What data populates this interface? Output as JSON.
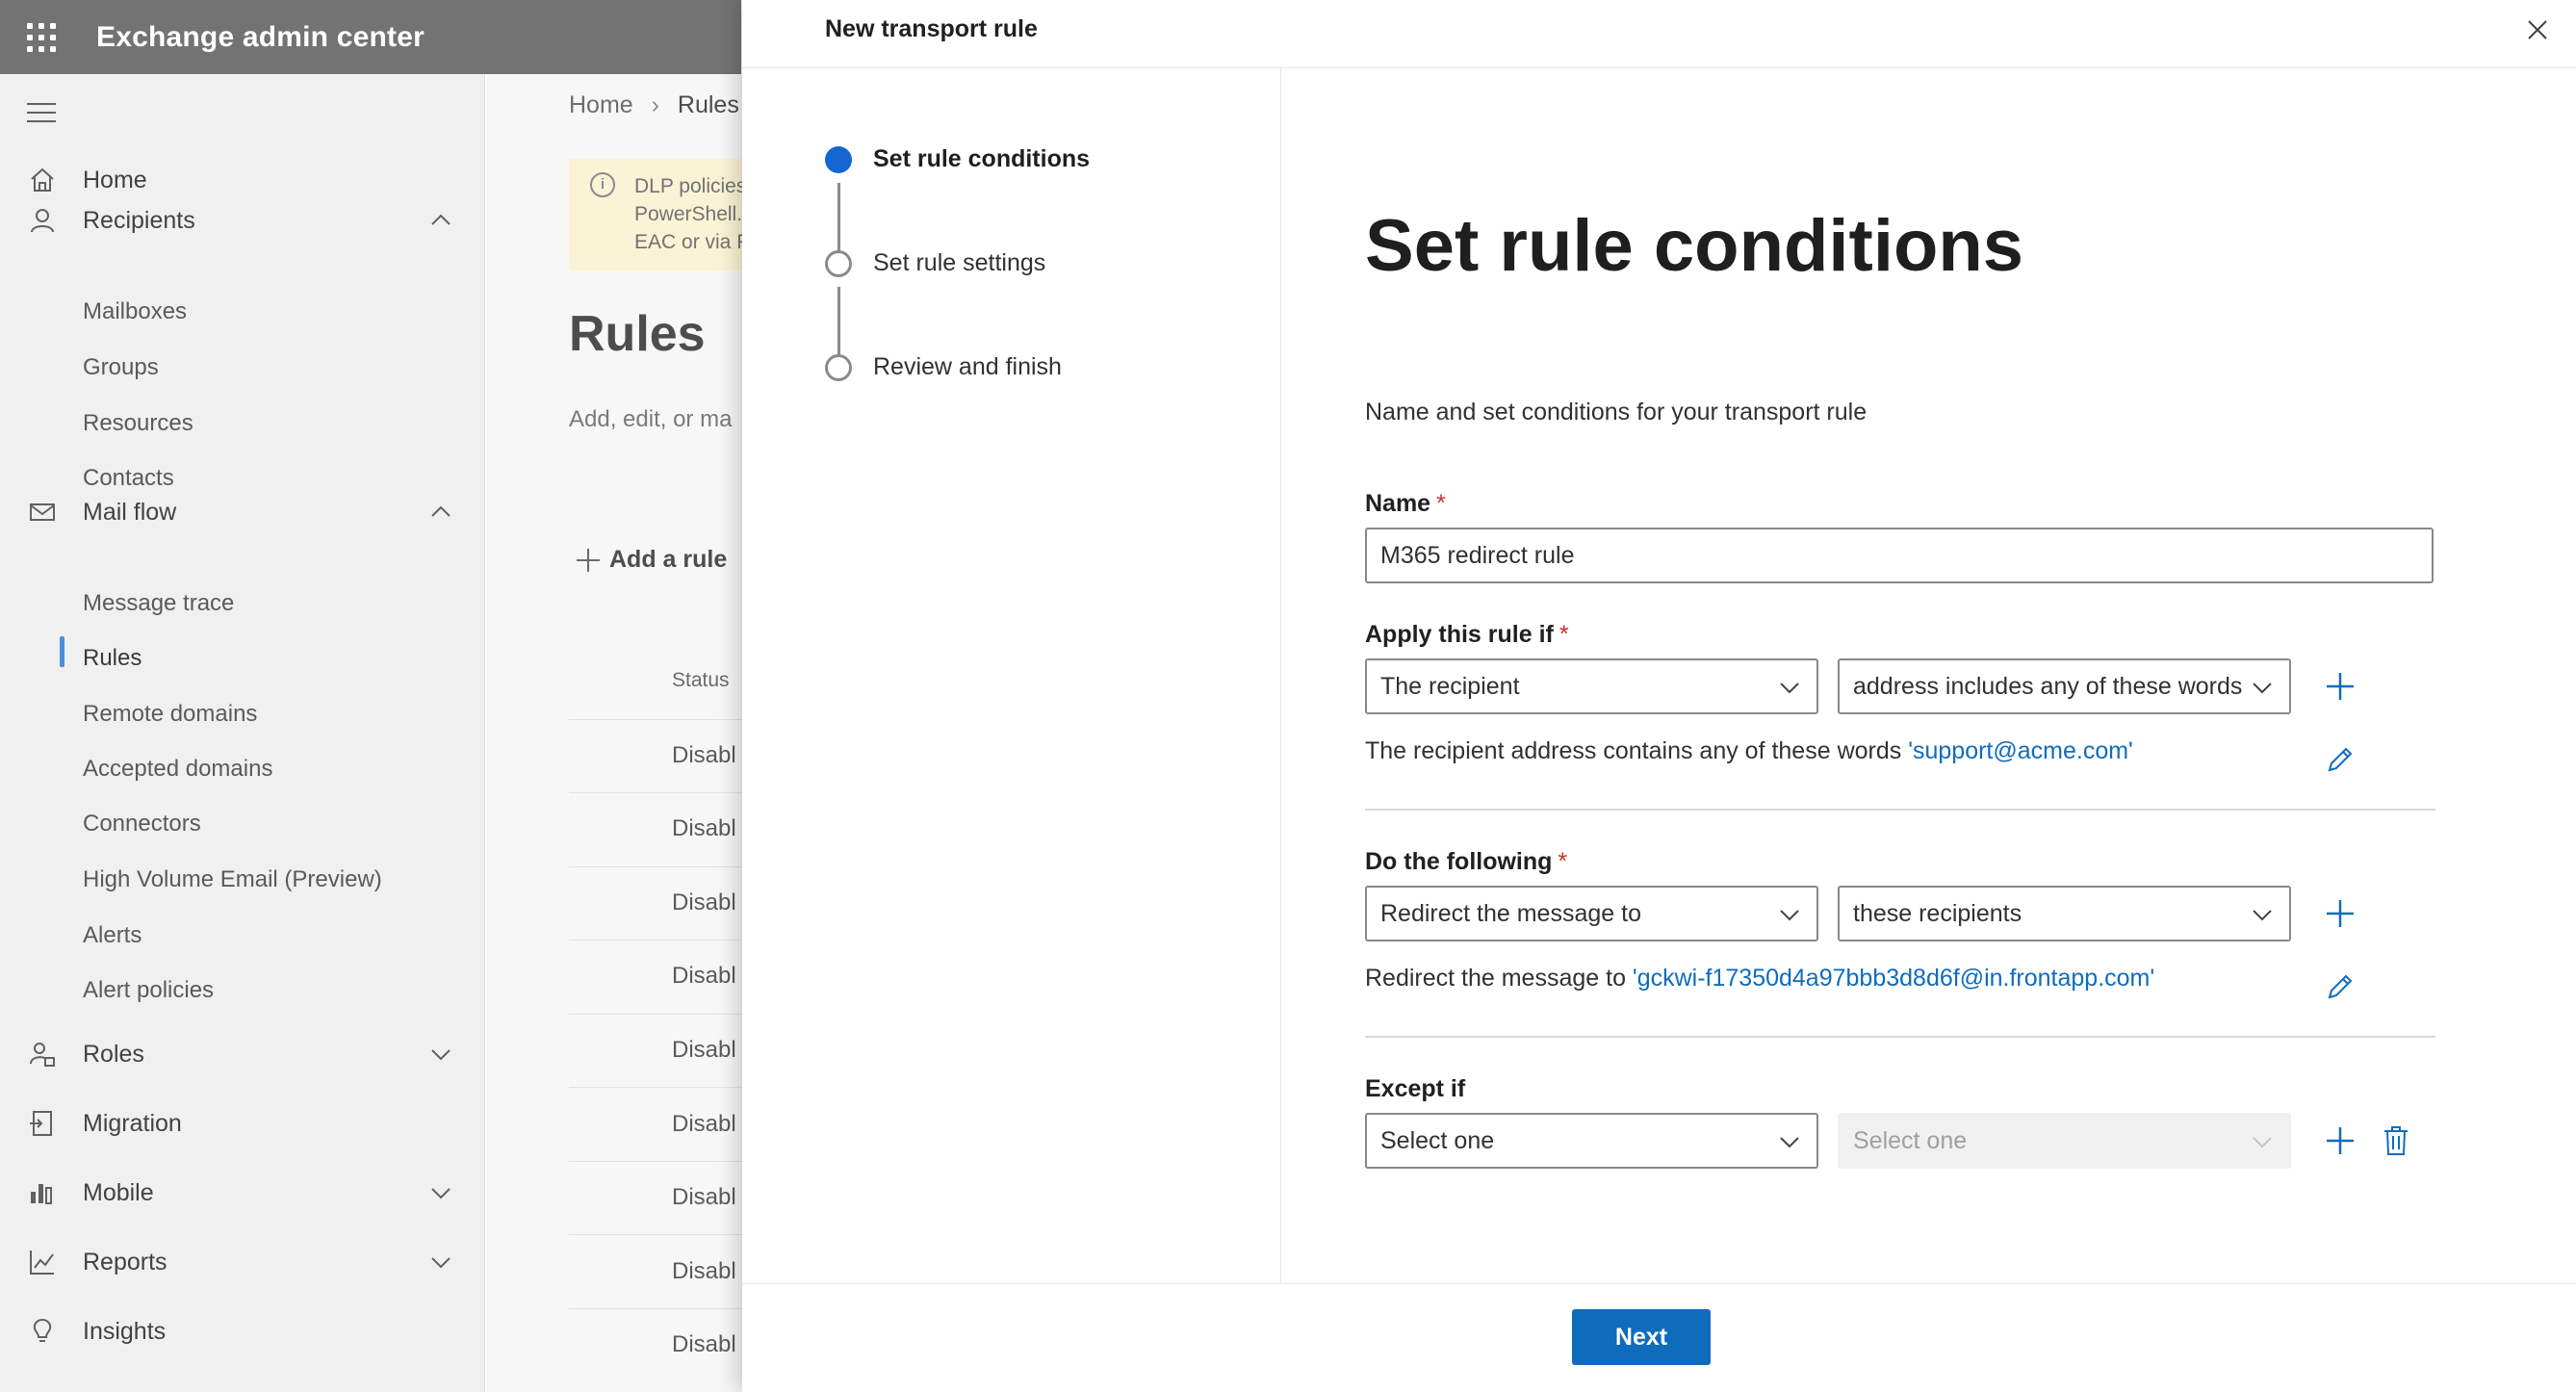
{
  "app": {
    "title": "Exchange admin center"
  },
  "sidebar": {
    "items": [
      {
        "label": "Home",
        "icon": "home-icon"
      },
      {
        "label": "Recipients",
        "icon": "person-icon",
        "expanded": true
      },
      {
        "label": "Mail flow",
        "icon": "mail-icon",
        "expanded": true
      },
      {
        "label": "Roles",
        "icon": "roles-icon",
        "expanded": false
      },
      {
        "label": "Migration",
        "icon": "migration-icon"
      },
      {
        "label": "Mobile",
        "icon": "mobile-icon",
        "expanded": false
      },
      {
        "label": "Reports",
        "icon": "reports-icon",
        "expanded": false
      },
      {
        "label": "Insights",
        "icon": "lightbulb-icon"
      }
    ],
    "recipients_sub": [
      "Mailboxes",
      "Groups",
      "Resources",
      "Contacts"
    ],
    "mailflow_sub": [
      "Message trace",
      "Rules",
      "Remote domains",
      "Accepted domains",
      "Connectors",
      "High Volume Email (Preview)",
      "Alerts",
      "Alert policies"
    ],
    "selected": "Rules"
  },
  "background": {
    "breadcrumb": {
      "home": "Home",
      "current": "Rules"
    },
    "banner_text": "DLP policies\nPowerShell.\nEAC or via P",
    "heading": "Rules",
    "subtext": "Add, edit, or ma",
    "add_rule": "Add a rule",
    "status_header": "Status",
    "rows": [
      "Disabl",
      "Disabl",
      "Disabl",
      "Disabl",
      "Disabl",
      "Disabl",
      "Disabl",
      "Disabl",
      "Disabl"
    ]
  },
  "panel": {
    "title": "New transport rule",
    "steps": [
      {
        "label": "Set rule conditions",
        "active": true
      },
      {
        "label": "Set rule settings",
        "active": false
      },
      {
        "label": "Review and finish",
        "active": false
      }
    ],
    "heading": "Set rule conditions",
    "description": "Name and set conditions for your transport rule",
    "name_label": "Name",
    "name_value": "M365 redirect rule",
    "apply": {
      "label": "Apply this rule if",
      "dropdown1": "The recipient",
      "dropdown2": "address includes any of these words",
      "summary_prefix": "The recipient address contains any of these words ",
      "summary_link": "'support@acme.com'"
    },
    "do": {
      "label": "Do the following",
      "dropdown1": "Redirect the message to",
      "dropdown2": "these recipients",
      "summary_prefix": "Redirect the message to ",
      "summary_link": "'gckwi-f17350d4a97bbb3d8d6f@in.frontapp.com'"
    },
    "except": {
      "label": "Except if",
      "dropdown1": "Select one",
      "dropdown2": "Select one"
    },
    "required_mark": "*",
    "next_label": "Next"
  },
  "colors": {
    "accent": "#0f6cbd",
    "required": "#c4312b",
    "step_active": "#1466d2",
    "topbar": "#737373"
  }
}
